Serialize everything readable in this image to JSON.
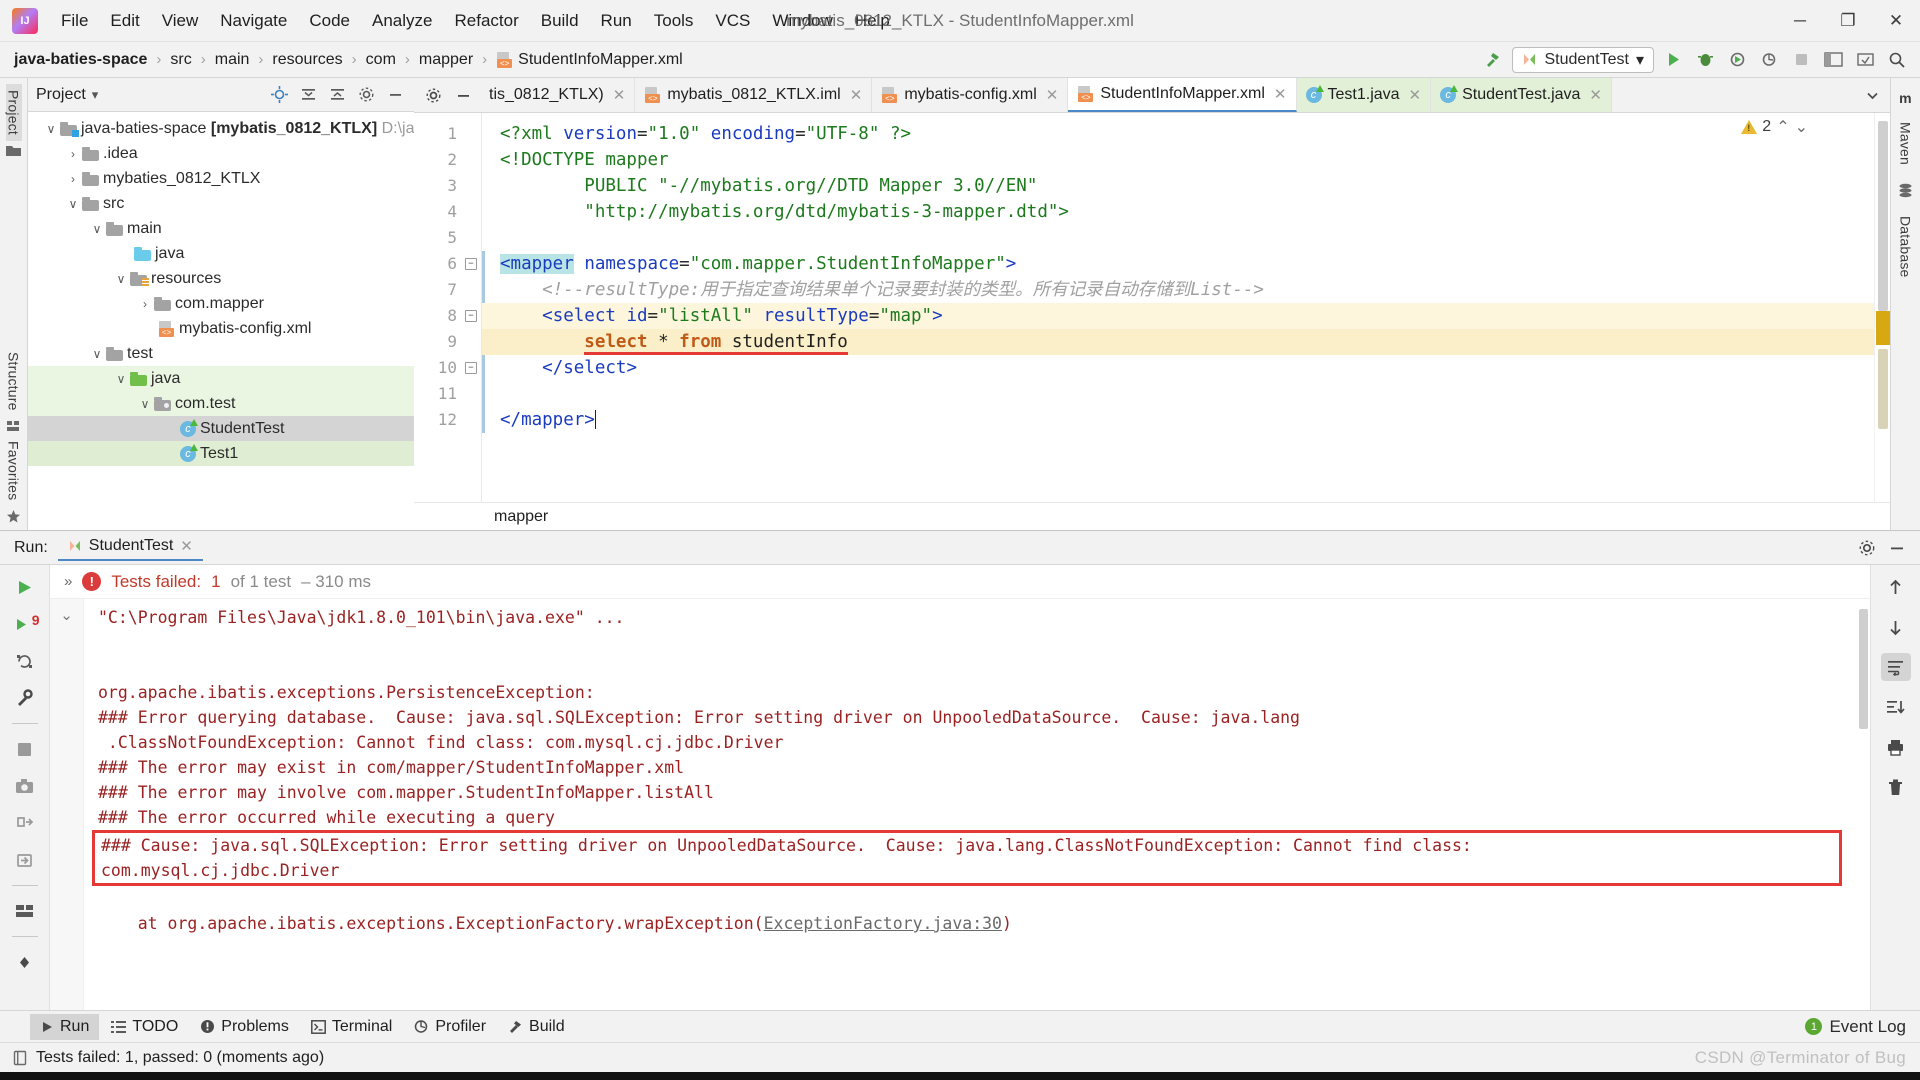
{
  "window": {
    "title": "mybatis_0812_KTLX - StudentInfoMapper.xml",
    "minimize": "─",
    "maximize": "❐",
    "close": "✕"
  },
  "menu": {
    "items": [
      "File",
      "Edit",
      "View",
      "Navigate",
      "Code",
      "Analyze",
      "Refactor",
      "Build",
      "Run",
      "Tools",
      "VCS",
      "Window",
      "Help"
    ]
  },
  "breadcrumb": {
    "items": [
      {
        "label": "java-baties-space",
        "icon": "",
        "bold": true
      },
      {
        "label": "src",
        "icon": "",
        "bold": false
      },
      {
        "label": "main",
        "icon": "",
        "bold": false
      },
      {
        "label": "resources",
        "icon": "",
        "bold": false
      },
      {
        "label": "com",
        "icon": "",
        "bold": false
      },
      {
        "label": "mapper",
        "icon": "",
        "bold": false
      },
      {
        "label": "StudentInfoMapper.xml",
        "icon": "xml-file-icon",
        "bold": false
      }
    ],
    "separator": "›"
  },
  "toolbar": {
    "build_icon": "hammer-icon",
    "run_config": "StudentTest",
    "run_config_caret": "▾",
    "run_icon": "run-icon",
    "debug_icon": "debug-icon",
    "coverage_icon": "run-with-coverage-icon",
    "profile_icon": "profiler-icon",
    "stop_icon": "stop-icon",
    "layout_icon": "layout-icon",
    "updates_icon": "updates-icon",
    "search_icon": "search-icon"
  },
  "left_rail": {
    "top": [
      "Project"
    ],
    "bottom": [
      "Structure",
      "Favorites"
    ]
  },
  "right_rail": {
    "items": [
      "m",
      "Maven",
      "Database"
    ]
  },
  "project_panel": {
    "title": "Project",
    "title_caret": "▾",
    "icons": [
      "locate-icon",
      "collapse-all-icon",
      "expand-icon",
      "settings-icon",
      "hide-icon"
    ],
    "tree": [
      {
        "label": "java-baties-space",
        "suffix": "[mybatis_0812_KTLX]",
        "path": "D:\\java",
        "indent": 0,
        "twist": "∨",
        "icon": "module-folder-icon",
        "state": "none"
      },
      {
        "label": ".idea",
        "indent": 1,
        "twist": "›",
        "icon": "folder-icon",
        "state": "none"
      },
      {
        "label": "mybaties_0812_KTLX",
        "indent": 1,
        "twist": "›",
        "icon": "folder-icon",
        "state": "none"
      },
      {
        "label": "src",
        "indent": 1,
        "twist": "∨",
        "icon": "folder-icon",
        "state": "none"
      },
      {
        "label": "main",
        "indent": 2,
        "twist": "∨",
        "icon": "folder-icon",
        "state": "none"
      },
      {
        "label": "java",
        "indent": 3,
        "twist": "",
        "icon": "source-folder-icon",
        "state": "none"
      },
      {
        "label": "resources",
        "indent": 3,
        "twist": "∨",
        "icon": "resources-folder-icon",
        "state": "none"
      },
      {
        "label": "com.mapper",
        "indent": 4,
        "twist": "›",
        "icon": "folder-icon",
        "state": "none"
      },
      {
        "label": "mybatis-config.xml",
        "indent": 4,
        "twist": "",
        "icon": "xml-file-icon",
        "state": "none"
      },
      {
        "label": "test",
        "indent": 2,
        "twist": "∨",
        "icon": "folder-icon",
        "state": "none"
      },
      {
        "label": "java",
        "indent": 3,
        "twist": "∨",
        "icon": "test-source-folder-icon",
        "state": "green"
      },
      {
        "label": "com.test",
        "indent": 4,
        "twist": "∨",
        "icon": "package-icon",
        "state": "green"
      },
      {
        "label": "StudentTest",
        "indent": 5,
        "twist": "",
        "icon": "java-class-icon",
        "state": "selected"
      },
      {
        "label": "Test1",
        "indent": 5,
        "twist": "",
        "icon": "java-class-icon",
        "state": "green2"
      }
    ]
  },
  "editor_tabs": {
    "left_icons": [
      "settings-icon",
      "hide-icon"
    ],
    "tabs": [
      {
        "label": "tis_0812_KTLX)",
        "icon": "",
        "state": "clipped"
      },
      {
        "label": "mybatis_0812_KTLX.iml",
        "icon": "iml-file-icon",
        "state": "normal"
      },
      {
        "label": "mybatis-config.xml",
        "icon": "xml-file-icon",
        "state": "normal"
      },
      {
        "label": "StudentInfoMapper.xml",
        "icon": "xml-file-icon",
        "state": "active"
      },
      {
        "label": "Test1.java",
        "icon": "java-class-icon",
        "state": "green"
      },
      {
        "label": "StudentTest.java",
        "icon": "java-class-icon",
        "state": "green"
      }
    ],
    "right_icons": [
      "chevron-down-icon"
    ]
  },
  "inspection": {
    "warning_count": "2",
    "up_arrow": "⌃",
    "down_arrow": "⌄"
  },
  "editor": {
    "lines": [
      {
        "num": "1",
        "fold": "",
        "highlight": "none",
        "tokens": [
          {
            "t": "<?",
            "c": "pi"
          },
          {
            "t": "xml",
            "c": "pi"
          },
          {
            "t": " ",
            "c": "plain"
          },
          {
            "t": "version",
            "c": "attr"
          },
          {
            "t": "=",
            "c": "plain"
          },
          {
            "t": "\"1.0\"",
            "c": "str"
          },
          {
            "t": " ",
            "c": "plain"
          },
          {
            "t": "encoding",
            "c": "attr"
          },
          {
            "t": "=",
            "c": "plain"
          },
          {
            "t": "\"UTF-8\"",
            "c": "str"
          },
          {
            "t": " ",
            "c": "plain"
          },
          {
            "t": "?>",
            "c": "pi"
          }
        ]
      },
      {
        "num": "2",
        "fold": "",
        "highlight": "none",
        "tokens": [
          {
            "t": "<!DOCTYPE ",
            "c": "pi"
          },
          {
            "t": "mapper",
            "c": "pi"
          }
        ]
      },
      {
        "num": "3",
        "fold": "",
        "highlight": "none",
        "tokens": [
          {
            "t": "        ",
            "c": "plain"
          },
          {
            "t": "PUBLIC ",
            "c": "pi"
          },
          {
            "t": "\"-//mybatis.org//DTD Mapper 3.0//EN\"",
            "c": "str"
          }
        ]
      },
      {
        "num": "4",
        "fold": "",
        "highlight": "none",
        "tokens": [
          {
            "t": "        ",
            "c": "plain"
          },
          {
            "t": "\"http://mybatis.org/dtd/mybatis-3-mapper.dtd\">",
            "c": "str"
          }
        ]
      },
      {
        "num": "5",
        "fold": "",
        "highlight": "none",
        "tokens": []
      },
      {
        "num": "6",
        "fold": "−",
        "highlight": "none",
        "tokens": [
          {
            "t": "<mapper",
            "c": "tag-sel"
          },
          {
            "t": " ",
            "c": "plain"
          },
          {
            "t": "namespace",
            "c": "attr"
          },
          {
            "t": "=",
            "c": "plain"
          },
          {
            "t": "\"com.mapper.StudentInfoMapper\"",
            "c": "str"
          },
          {
            "t": ">",
            "c": "tag"
          }
        ]
      },
      {
        "num": "7",
        "fold": "",
        "highlight": "none",
        "tokens": [
          {
            "t": "    <!--resultType:用于指定查询结果单个记录要封装的类型。所有记录自动存储到List-->",
            "c": "cmt"
          }
        ]
      },
      {
        "num": "8",
        "fold": "−",
        "highlight": "soft",
        "tokens": [
          {
            "t": "    ",
            "c": "plain"
          },
          {
            "t": "<select",
            "c": "tag"
          },
          {
            "t": " ",
            "c": "plain"
          },
          {
            "t": "id",
            "c": "attr"
          },
          {
            "t": "=",
            "c": "plain"
          },
          {
            "t": "\"listAll\"",
            "c": "str"
          },
          {
            "t": " ",
            "c": "plain"
          },
          {
            "t": "resultType",
            "c": "attr"
          },
          {
            "t": "=",
            "c": "plain"
          },
          {
            "t": "\"map\"",
            "c": "str"
          },
          {
            "t": ">",
            "c": "tag"
          }
        ]
      },
      {
        "num": "9",
        "fold": "",
        "highlight": "strong",
        "tokens": [
          {
            "t": "        ",
            "c": "plain"
          },
          {
            "t": "select",
            "c": "kw-underline"
          },
          {
            "t": " ",
            "c": "plain"
          },
          {
            "t": "*",
            "c": "plain-underline"
          },
          {
            "t": " ",
            "c": "plain"
          },
          {
            "t": "from",
            "c": "kw-underline"
          },
          {
            "t": " ",
            "c": "plain"
          },
          {
            "t": "studentInfo",
            "c": "plain-underline"
          }
        ]
      },
      {
        "num": "10",
        "fold": "−",
        "highlight": "none",
        "tokens": [
          {
            "t": "    ",
            "c": "plain"
          },
          {
            "t": "</select>",
            "c": "tag"
          }
        ]
      },
      {
        "num": "11",
        "fold": "",
        "highlight": "none",
        "tokens": []
      },
      {
        "num": "12",
        "fold": "",
        "highlight": "none",
        "tokens": [
          {
            "t": "</mapper>",
            "c": "tag"
          },
          {
            "t": "|",
            "c": "caret"
          }
        ]
      }
    ],
    "bottom_breadcrumb": "mapper"
  },
  "run_panel": {
    "label": "Run:",
    "tab": "StudentTest",
    "tab_close": "✕",
    "head_icons": [
      "settings-icon",
      "hide-icon"
    ],
    "left_icons": [
      "rerun-icon",
      "rerun-failed-icon",
      "toggle-auto-test-icon",
      "test-settings-icon",
      "stop-icon",
      "screenshot-icon",
      "export-icon",
      "import-icon",
      "layout-icon",
      "pin-icon"
    ],
    "right_icons": [
      "up-arrow-icon",
      "down-arrow-icon",
      "soft-wrap-icon",
      "scroll-to-end-icon",
      "print-icon",
      "trash-icon"
    ],
    "rerun_failed_badge": "9",
    "status": {
      "expand": "»",
      "failed_label": "Tests failed:",
      "failed_count": "1",
      "of_text": "of 1 test",
      "duration": "– 310 ms"
    },
    "console": [
      {
        "text": "\"C:\\Program Files\\Java\\jdk1.8.0_101\\bin\\java.exe\" ...",
        "style": "cmd"
      },
      {
        "text": "",
        "style": "blank"
      },
      {
        "text": "",
        "style": "blank"
      },
      {
        "text": "org.apache.ibatis.exceptions.PersistenceException:",
        "style": "err"
      },
      {
        "text": "### Error querying database.  Cause: java.sql.SQLException: Error setting driver on UnpooledDataSource.  Cause: java.lang",
        "style": "err"
      },
      {
        "text": " .ClassNotFoundException: Cannot find class: com.mysql.cj.jdbc.Driver",
        "style": "err"
      },
      {
        "text": "### The error may exist in com/mapper/StudentInfoMapper.xml",
        "style": "err"
      },
      {
        "text": "### The error may involve com.mapper.StudentInfoMapper.listAll",
        "style": "err"
      },
      {
        "text": "### The error occurred while executing a query",
        "style": "err"
      }
    ],
    "console_boxed": [
      {
        "text": "### Cause: java.sql.SQLException: Error setting driver on UnpooledDataSource.  Cause: java.lang.ClassNotFoundException: Cannot find class:",
        "style": "err"
      },
      {
        "text": "com.mysql.cj.jdbc.Driver",
        "style": "err"
      }
    ],
    "console_after": [
      {
        "text": "",
        "style": "blank"
      },
      {
        "prefix": "    at org.apache.ibatis.exceptions.ExceptionFactory.wrapException(",
        "link": "ExceptionFactory.java:30",
        "suffix": ")",
        "style": "err-link"
      }
    ]
  },
  "toolwindow_bar": {
    "items": [
      {
        "label": "Run",
        "icon": "run-icon",
        "active": true
      },
      {
        "label": "TODO",
        "icon": "todo-icon",
        "active": false
      },
      {
        "label": "Problems",
        "icon": "problems-icon",
        "active": false
      },
      {
        "label": "Terminal",
        "icon": "terminal-icon",
        "active": false
      },
      {
        "label": "Profiler",
        "icon": "profiler-icon",
        "active": false
      },
      {
        "label": "Build",
        "icon": "build-icon",
        "active": false
      }
    ],
    "event_log": "Event Log",
    "event_log_badge": "1"
  },
  "statusbar": {
    "message": "Tests failed: 1, passed: 0 (moments ago)",
    "icon": "notification-icon",
    "watermark": "CSDN @Terminator of Bug"
  },
  "colors": {
    "accent_blue": "#4a88c7",
    "error_red": "#e53935",
    "console_err": "#9a2222",
    "highlight_yellow": "#faefc8",
    "green_tab": "#e3f0d8",
    "warning_yellow": "#e8b931"
  }
}
